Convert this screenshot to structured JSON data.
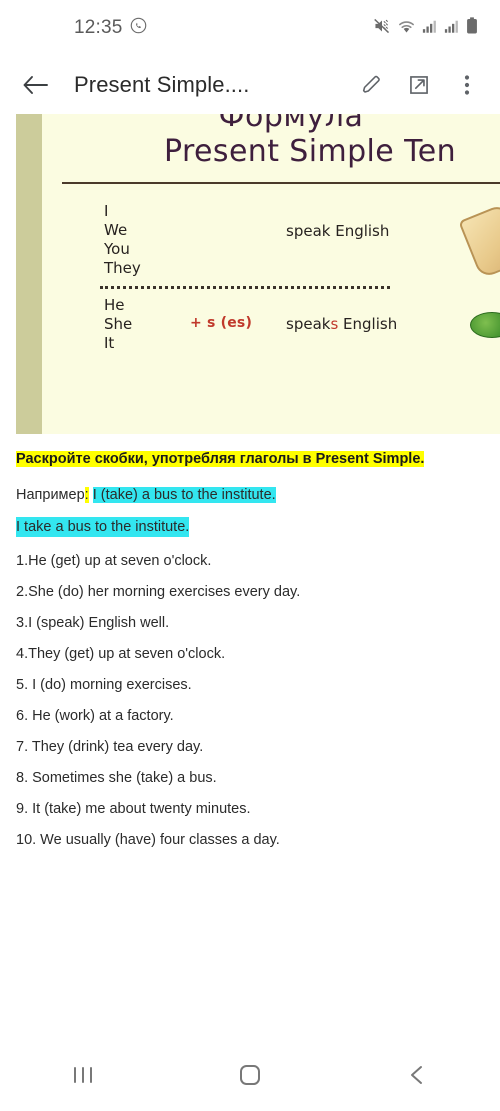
{
  "statusbar": {
    "time": "12:35",
    "icons": [
      "whatsapp-icon",
      "mute-icon",
      "wifi-icon",
      "signal-icon-1",
      "signal-icon-2",
      "battery-icon"
    ]
  },
  "appbar": {
    "back_label": "back-arrow",
    "title": "Present Simple....",
    "actions": [
      "edit-pencil",
      "open-external",
      "overflow-menu"
    ]
  },
  "slide": {
    "title_line1": "Формула",
    "title_line2": "Present Simple Ten",
    "rows": [
      {
        "pronouns": [
          "I",
          "We",
          "You",
          "They"
        ],
        "suffix": "",
        "verb_prefix": "speak",
        "verb_red": "",
        "verb_suffix": " English"
      },
      {
        "pronouns": [
          "He",
          "She",
          "It"
        ],
        "suffix": "+ s (es)",
        "verb_prefix": "speak",
        "verb_red": "s",
        "verb_suffix": " English"
      }
    ]
  },
  "document": {
    "task": "Раскройте скобки, употребляя глаголы в Present Simple.",
    "example_label": "Например",
    "example_colon": ":",
    "example_source": "I (take) a bus to the institute.",
    "example_answer": "I take a bus to the institute.",
    "questions": [
      "1.He (get) up at seven o'clock.",
      "2.She (do) her morning exercises every day.",
      "3.I (speak) English well.",
      "4.They (get) up at seven o'clock.",
      "5. I (do) morning exercises.",
      "6. He (work) at a factory.",
      "7. They (drink) tea every day.",
      "8. Sometimes she (take) a bus.",
      "9. It (take) me about twenty minutes.",
      "10. We usually (have) four classes a day."
    ]
  },
  "navbar": {
    "recents": "recents-icon",
    "home": "home-icon",
    "back": "back-icon"
  },
  "colors": {
    "highlight_yellow": "#FFFF00",
    "highlight_cyan": "#33E6F0",
    "slide_background": "#FBFCE1",
    "slide_stripe": "#CCCC9B",
    "slide_title": "#3E1F3D",
    "accent_red": "#C0392B"
  }
}
